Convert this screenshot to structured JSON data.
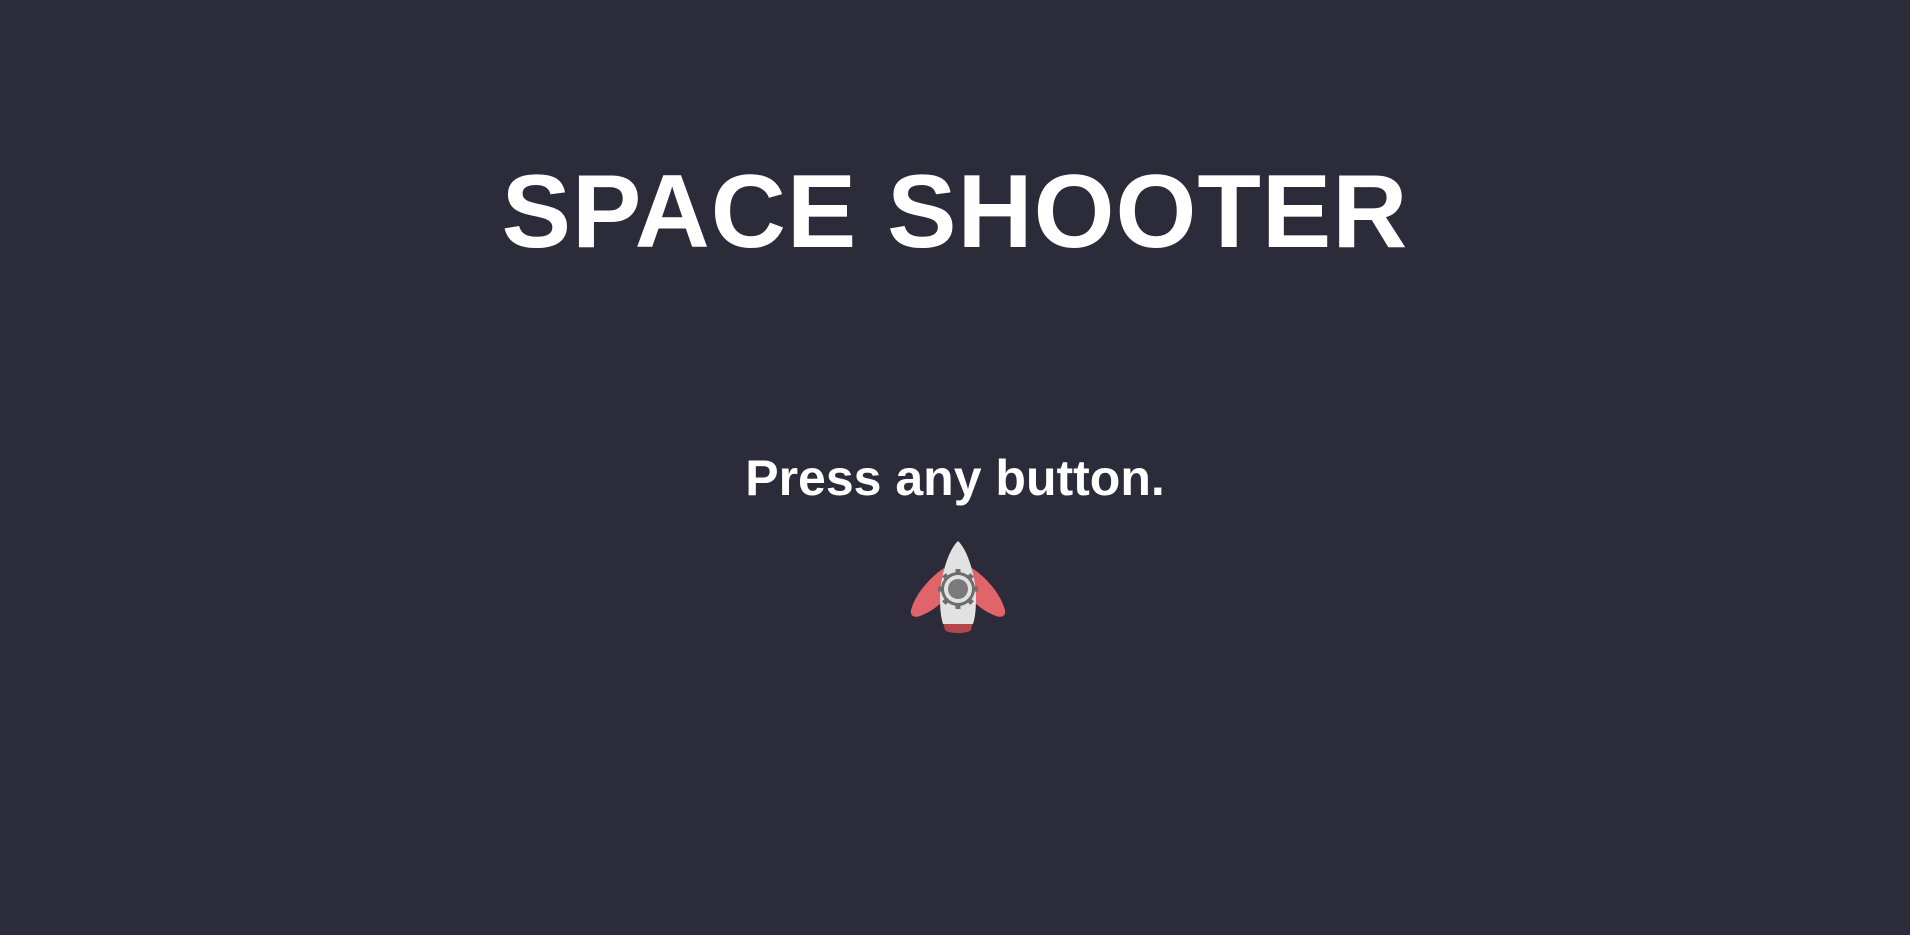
{
  "game": {
    "title": "SPACE SHOOTER",
    "prompt": "Press any button.",
    "player_ship_icon": "rocket-icon"
  },
  "colors": {
    "background": "#2c2b3a",
    "text": "#ffffff",
    "ship_wing": "#e06469",
    "ship_body": "#e2e2e2",
    "ship_porthole": "#7a7a7a",
    "ship_exhaust": "#b5454d"
  }
}
